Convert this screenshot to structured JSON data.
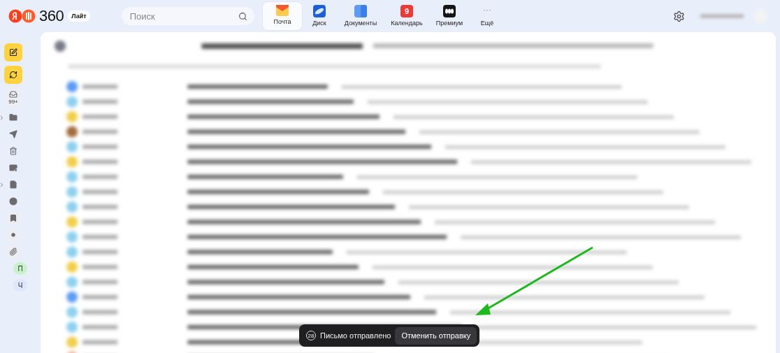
{
  "header": {
    "logo": {
      "text": "360",
      "badge": "Лайт"
    },
    "search": {
      "placeholder": "Поиск"
    },
    "apps": [
      {
        "kind": "mail",
        "label": "Почта",
        "selected": true
      },
      {
        "kind": "disk",
        "label": "Диск",
        "selected": false
      },
      {
        "kind": "docs",
        "label": "Документы",
        "selected": false
      },
      {
        "kind": "calendar",
        "label": "Календарь",
        "selected": false,
        "badge": "9"
      },
      {
        "kind": "premium",
        "label": "Премиум",
        "selected": false
      },
      {
        "kind": "more",
        "label": "Ещё",
        "selected": false,
        "glyph": "···"
      }
    ]
  },
  "sidebar": {
    "items": [
      {
        "kind": "compose"
      },
      {
        "kind": "refresh"
      },
      {
        "kind": "inbox",
        "count": "99+"
      },
      {
        "kind": "folder",
        "expandable": true
      },
      {
        "kind": "sent"
      },
      {
        "kind": "trash"
      },
      {
        "kind": "spam"
      },
      {
        "kind": "drafts",
        "expandable": true
      },
      {
        "kind": "scheduled"
      },
      {
        "kind": "bookmark"
      },
      {
        "kind": "unread"
      },
      {
        "kind": "attachments"
      },
      {
        "kind": "label",
        "text": "П",
        "color": "#c9f2cc"
      },
      {
        "kind": "label",
        "text": "Ч",
        "color": "#dde6fb"
      }
    ]
  },
  "toast": {
    "countdown": "28",
    "message": "Письмо отправлено",
    "action": "Отменить отправку"
  }
}
